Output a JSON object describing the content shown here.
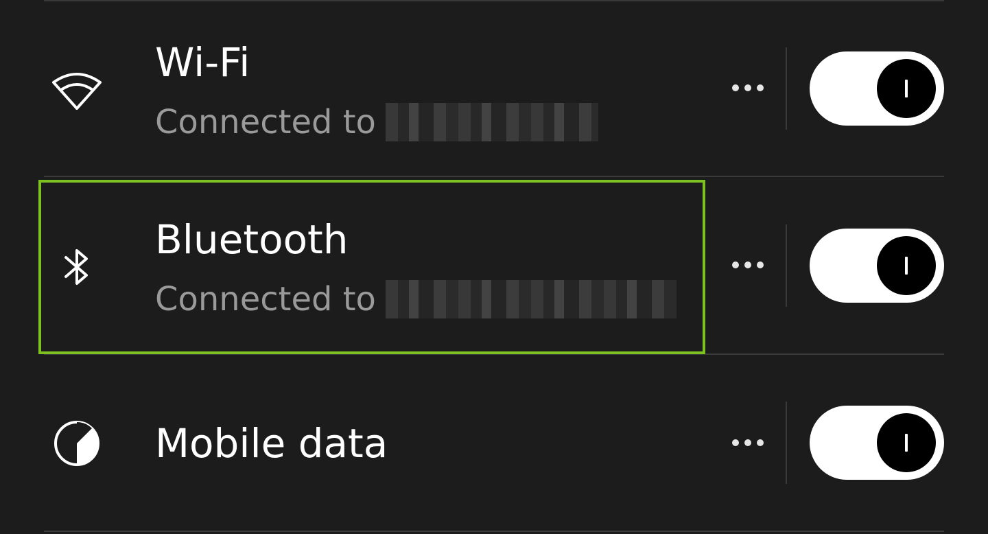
{
  "rows": [
    {
      "title": "Wi-Fi",
      "subtitle": "Connected to",
      "icon": "wifi-icon",
      "toggle_on": true
    },
    {
      "title": "Bluetooth",
      "subtitle": "Connected to",
      "icon": "bluetooth-icon",
      "toggle_on": true
    },
    {
      "title": "Mobile data",
      "icon": "mobile-data-icon",
      "toggle_on": true
    }
  ],
  "colors": {
    "background": "#1c1c1c",
    "highlight": "#7cc11f",
    "toggle_track": "#ffffff",
    "toggle_knob": "#000000",
    "subtitle": "#9a9a9a"
  }
}
